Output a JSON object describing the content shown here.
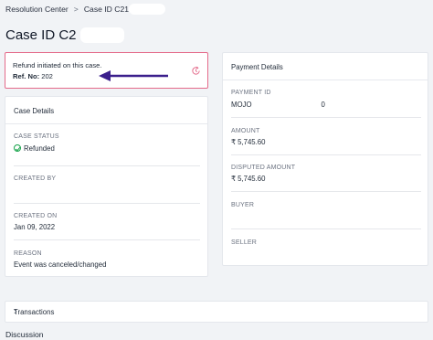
{
  "breadcrumb": {
    "root": "Resolution Center",
    "separator": ">",
    "current": "Case ID C21"
  },
  "page": {
    "title": "Case ID C2"
  },
  "refund_notice": {
    "message": "Refund initiated on this case.",
    "ref_label": "Ref. No:",
    "ref_value": "202"
  },
  "case_details": {
    "heading": "Case Details",
    "status_label": "CASE STATUS",
    "status_value": "Refunded",
    "created_by_label": "CREATED BY",
    "created_by_value": "",
    "created_on_label": "CREATED ON",
    "created_on_value": "Jan 09, 2022",
    "reason_label": "REASON",
    "reason_value": "Event was canceled/changed"
  },
  "payment_details": {
    "heading": "Payment Details",
    "payment_id_label": "PAYMENT ID",
    "payment_id_prefix": "MOJO",
    "payment_id_suffix": "0",
    "amount_label": "AMOUNT",
    "amount_value": "₹ 5,745.60",
    "disputed_label": "DISPUTED AMOUNT",
    "disputed_value": "₹ 5,745.60",
    "buyer_label": "BUYER",
    "buyer_value": "",
    "seller_label": "SELLER",
    "seller_value": ""
  },
  "transactions": {
    "label": "Transactions",
    "chevron": "›"
  },
  "discussion": {
    "label": "Discussion"
  },
  "colors": {
    "accent_border": "#e46a8a",
    "arrow": "#3b1f8c",
    "status_green": "#16a34a"
  }
}
